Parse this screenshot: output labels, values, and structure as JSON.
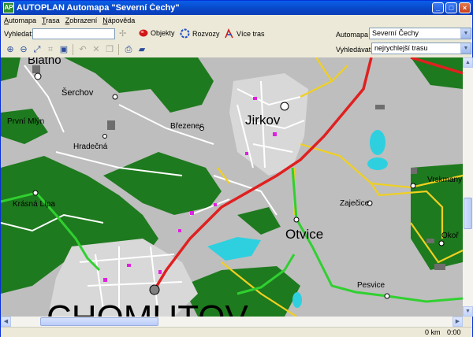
{
  "window": {
    "title": "AUTOPLAN Automapa \"Severní Čechy\"",
    "app_icon_text": "AP",
    "minimize": "_",
    "maximize": "□",
    "close": "×"
  },
  "menu": [
    "Automapa",
    "Trasa",
    "Zobrazení",
    "Nápověda"
  ],
  "search": {
    "label": "Vyhledat:",
    "value": "",
    "objects_label": "Objekty",
    "junctions_label": "Rozvozy",
    "multi_route_label": "Více tras"
  },
  "automapa": {
    "label": "Automapa",
    "value": "Severní Čechy"
  },
  "vyhledavat": {
    "label": "Vyhledávat",
    "value": "nejrychlejší trasu"
  },
  "map": {
    "places": {
      "blatno": "Blatno",
      "serchov": "Šerchov",
      "prvni_mlyn": "První Mlýn",
      "hradecna": "Hradečná",
      "brezenec": "Březenec",
      "jirkov": "Jirkov",
      "krasna_lipa": "Krásná Lípa",
      "zajecice": "Zaječice",
      "vrskmany": "Vrskmany",
      "otvice": "Otvice",
      "okoun": "Okoř",
      "pesvice": "Pesvice",
      "chomutov": "CHOMUTOV"
    },
    "colors": {
      "land": "#BEBEBE",
      "forest": "#1E7A1E",
      "water": "#2ED0E0",
      "main_route": "#E02020",
      "green_route": "#30D030",
      "yellow_road": "#F0D020",
      "urban": "#E8E8E8"
    }
  },
  "status": {
    "distance": "0 km",
    "time": "0:00"
  }
}
